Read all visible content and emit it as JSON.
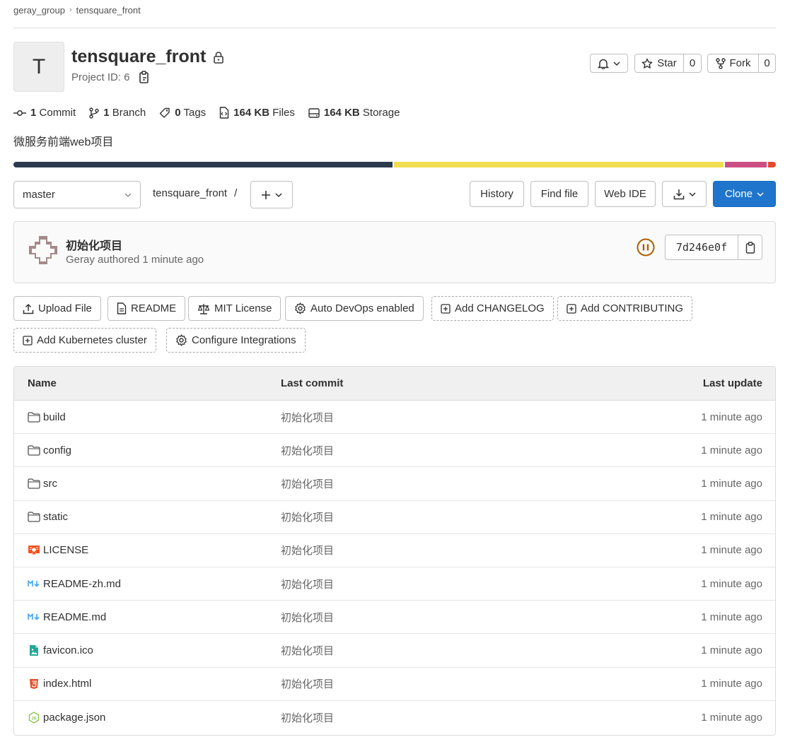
{
  "breadcrumb": {
    "group": "geray_group",
    "project": "tensquare_front"
  },
  "project": {
    "avatar_letter": "T",
    "name": "tensquare_front",
    "id_label": "Project ID: 6",
    "description": "微服务前端web项目"
  },
  "actions": {
    "star_label": "Star",
    "star_count": "0",
    "fork_label": "Fork",
    "fork_count": "0"
  },
  "stats": {
    "commits_num": "1",
    "commits_label": "Commit",
    "branches_num": "1",
    "branches_label": "Branch",
    "tags_num": "0",
    "tags_label": "Tags",
    "files_num": "164 KB",
    "files_label": "Files",
    "storage_num": "164 KB",
    "storage_label": "Storage"
  },
  "languages": [
    {
      "color": "#2b3a4d",
      "fraction": 0.5
    },
    {
      "color": "#f1dd52",
      "fraction": 0.435
    },
    {
      "color": "#cc4f83",
      "fraction": 0.055
    },
    {
      "color": "#e24a2d",
      "fraction": 0.01
    }
  ],
  "repo_nav": {
    "branch": "master",
    "path_root": "tensquare_front",
    "path_sep": "/",
    "history": "History",
    "find_file": "Find file",
    "web_ide": "Web IDE",
    "clone": "Clone"
  },
  "last_commit": {
    "title": "初始化项目",
    "meta": "Geray authored 1 minute ago",
    "sha": "7d246e0f"
  },
  "shortcuts": [
    {
      "label": "Upload File"
    },
    {
      "label": "README"
    },
    {
      "label": "MIT License"
    },
    {
      "label": "Auto DevOps enabled"
    },
    {
      "label": "Add CHANGELOG"
    },
    {
      "label": "Add CONTRIBUTING"
    },
    {
      "label": "Add Kubernetes cluster"
    },
    {
      "label": "Configure Integrations"
    }
  ],
  "table": {
    "headers": {
      "name": "Name",
      "last_commit": "Last commit",
      "last_update": "Last update"
    },
    "rows": [
      {
        "name": "build",
        "icon": "folder-icon",
        "commit": "初始化项目",
        "updated": "1 minute ago"
      },
      {
        "name": "config",
        "icon": "folder-icon",
        "commit": "初始化项目",
        "updated": "1 minute ago"
      },
      {
        "name": "src",
        "icon": "folder-icon",
        "commit": "初始化项目",
        "updated": "1 minute ago"
      },
      {
        "name": "static",
        "icon": "folder-icon",
        "commit": "初始化项目",
        "updated": "1 minute ago"
      },
      {
        "name": "LICENSE",
        "icon": "license-file-icon",
        "commit": "初始化项目",
        "updated": "1 minute ago"
      },
      {
        "name": "README-zh.md",
        "icon": "markdown-file-icon",
        "commit": "初始化项目",
        "updated": "1 minute ago"
      },
      {
        "name": "README.md",
        "icon": "markdown-file-icon",
        "commit": "初始化项目",
        "updated": "1 minute ago"
      },
      {
        "name": "favicon.ico",
        "icon": "image-file-icon",
        "commit": "初始化项目",
        "updated": "1 minute ago"
      },
      {
        "name": "index.html",
        "icon": "html-file-icon",
        "commit": "初始化项目",
        "updated": "1 minute ago"
      },
      {
        "name": "package.json",
        "icon": "nodejs-file-icon",
        "commit": "初始化项目",
        "updated": "1 minute ago"
      }
    ]
  }
}
